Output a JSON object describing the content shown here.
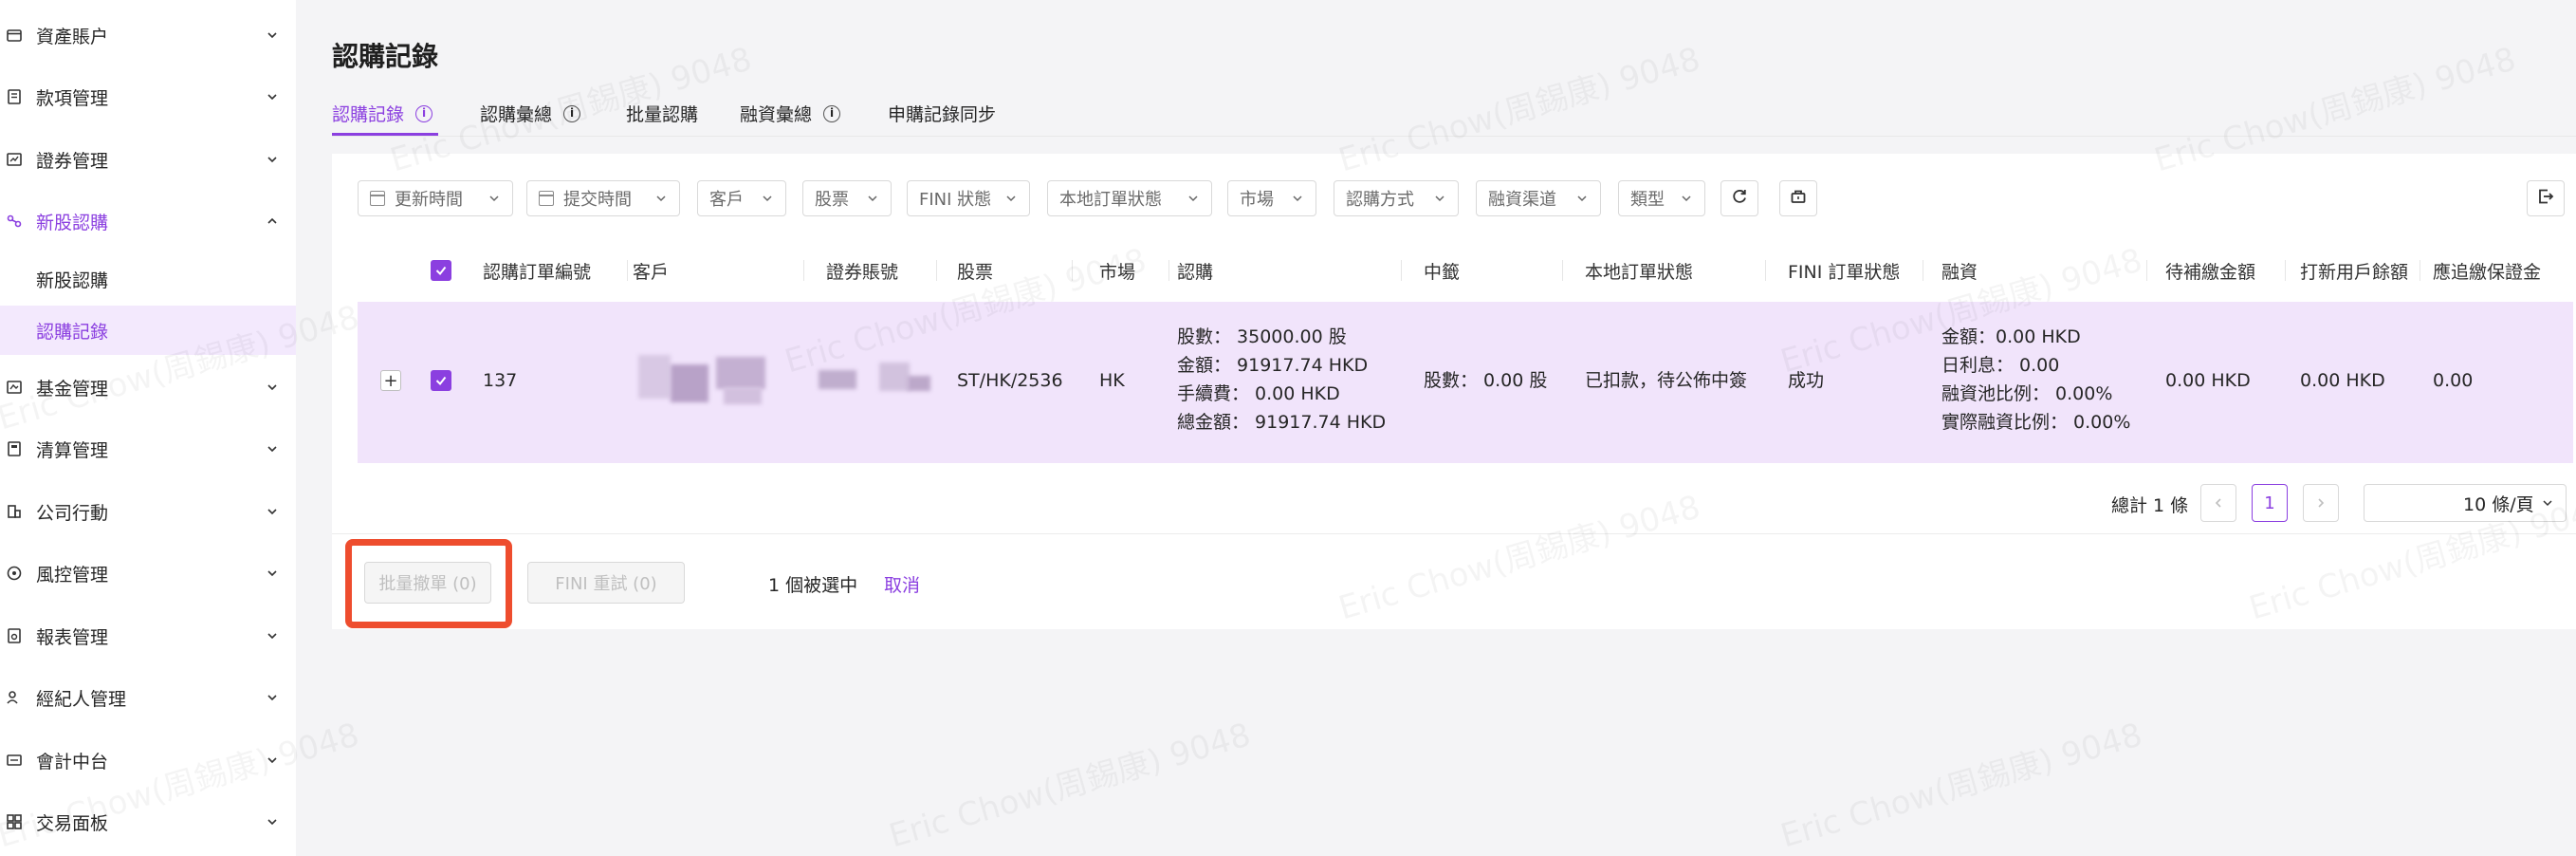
{
  "sidebar": {
    "items": [
      {
        "label": "資產賬户",
        "icon": "wallet-icon"
      },
      {
        "label": "款項管理",
        "icon": "receipt-icon"
      },
      {
        "label": "證券管理",
        "icon": "chart-icon"
      },
      {
        "label": "新股認購",
        "icon": "ipo-icon",
        "expanded": true
      },
      {
        "label": "基金管理",
        "icon": "fund-icon"
      },
      {
        "label": "清算管理",
        "icon": "calculator-icon"
      },
      {
        "label": "公司行動",
        "icon": "building-icon"
      },
      {
        "label": "風控管理",
        "icon": "shield-icon"
      },
      {
        "label": "報表管理",
        "icon": "report-icon"
      },
      {
        "label": "經紀人管理",
        "icon": "users-icon"
      },
      {
        "label": "會計中台",
        "icon": "ledger-icon"
      },
      {
        "label": "交易面板",
        "icon": "grid-icon"
      }
    ],
    "sub_items": [
      {
        "label": "新股認購"
      },
      {
        "label": "認購記錄",
        "selected": true
      }
    ]
  },
  "page": {
    "title": "認購記錄",
    "tabs": [
      {
        "label": "認購記錄",
        "active": true,
        "has_info": true
      },
      {
        "label": "認購彙總",
        "has_info": true
      },
      {
        "label": "批量認購"
      },
      {
        "label": "融資彙總",
        "has_info": true
      },
      {
        "label": "申購記錄同步"
      }
    ]
  },
  "filters": [
    {
      "label": "更新時間",
      "calendar": true
    },
    {
      "label": "提交時間",
      "calendar": true
    },
    {
      "label": "客戶"
    },
    {
      "label": "股票"
    },
    {
      "label": "FINI 狀態"
    },
    {
      "label": "本地訂單狀態"
    },
    {
      "label": "市場"
    },
    {
      "label": "認購方式"
    },
    {
      "label": "融資渠道"
    },
    {
      "label": "類型"
    }
  ],
  "table": {
    "columns": [
      "認購訂單編號",
      "客戶",
      "證券賬號",
      "股票",
      "市場",
      "認購",
      "中籤",
      "本地訂單狀態",
      "FINI 訂單狀態",
      "融資",
      "待補繳金額",
      "打新用戶餘額",
      "應追繳保證金"
    ],
    "rows": [
      {
        "order_id": "137",
        "stock": "ST/HK/2536",
        "market": "HK",
        "subscription": [
          "股數： 35000.00 股",
          "金額： 91917.74 HKD",
          "手續費： 0.00 HKD",
          "總金額： 91917.74 HKD"
        ],
        "allotment": "股數： 0.00 股",
        "local_status": "已扣款，待公佈中簽",
        "fini_status": "成功",
        "financing": [
          "金額：0.00 HKD",
          "日利息： 0.00",
          "融資池比例： 0.00%",
          "實際融資比例： 0.00%"
        ],
        "pending_amount": "0.00 HKD",
        "user_balance": "0.00 HKD",
        "margin_call": "0.00"
      }
    ]
  },
  "pagination": {
    "total": "總計 1 條",
    "current_page": "1",
    "page_size": "10 條/頁"
  },
  "footer": {
    "batch_cancel": "批量撤單 (0)",
    "fini_retry": "FINI 重試 (0)",
    "selected_text": "1 個被選中",
    "cancel_link": "取消"
  },
  "watermark": "Eric Chow(周錫康) 9048",
  "colors": {
    "accent": "#8b3fe0",
    "row_highlight": "#f1e4fb",
    "annotation": "#ee4d2e"
  }
}
